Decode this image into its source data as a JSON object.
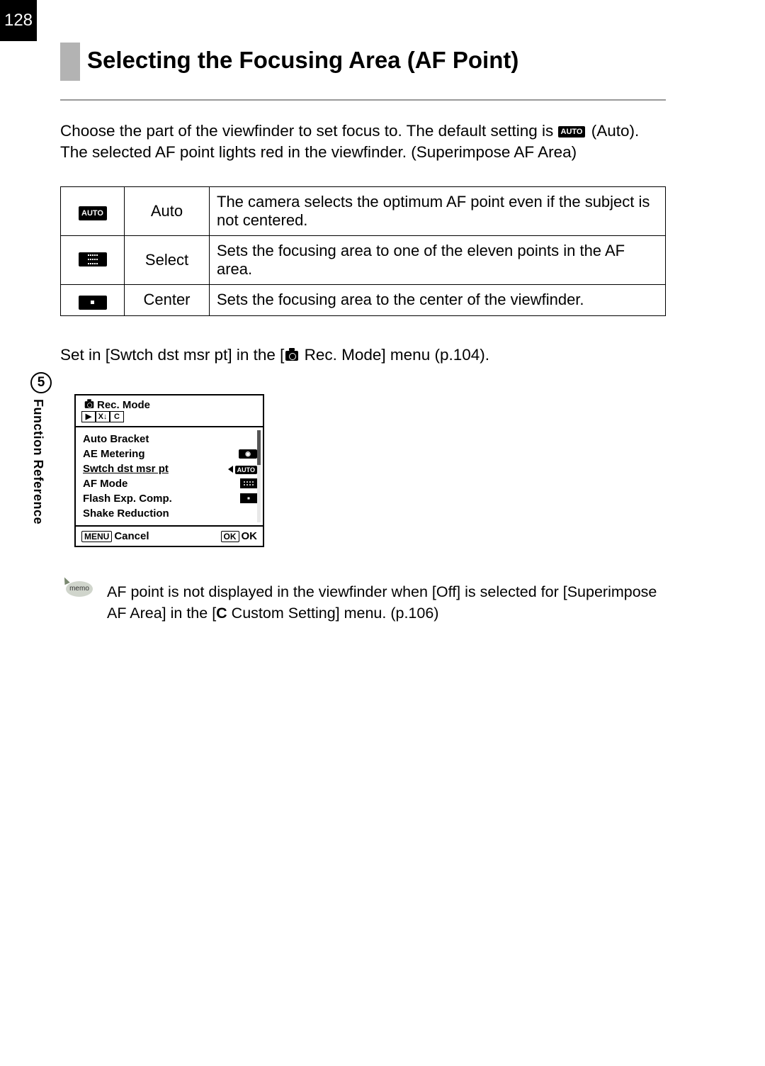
{
  "page_number": "128",
  "chapter": {
    "number": "5",
    "label": "Function Reference"
  },
  "title": "Selecting the Focusing Area (AF Point)",
  "intro": {
    "line1_a": "Choose the part of the viewfinder to set focus to. The default setting is ",
    "auto_badge": "AUTO",
    "line1_b": " (Auto).",
    "line2": "The selected AF point lights red in the viewfinder. (Superimpose AF Area)"
  },
  "table": [
    {
      "icon_text": "AUTO",
      "label": "Auto",
      "desc": "The camera selects the optimum AF point even if the subject is not centered."
    },
    {
      "icon_text": "",
      "label": "Select",
      "desc": "Sets the focusing area to one of the eleven points in the AF area."
    },
    {
      "icon_text": "",
      "label": "Center",
      "desc": "Sets the focusing area to the center of the viewfinder."
    }
  ],
  "setin": {
    "a": "Set in [Swtch dst msr pt] in the [",
    "b": " Rec. Mode] menu (p.104)."
  },
  "menu": {
    "title": "Rec. Mode",
    "tabs": [
      "▶",
      "X↓",
      "C"
    ],
    "items": [
      "Auto Bracket",
      "AE Metering",
      "Swtch dst msr pt",
      "AF Mode",
      "Flash Exp. Comp.",
      "Shake Reduction"
    ],
    "value_auto": "AUTO",
    "footer_menu": "MENU",
    "footer_cancel": "Cancel",
    "footer_ok_box": "OK",
    "footer_ok": "OK"
  },
  "memo": {
    "icon_label": "memo",
    "text_a": "AF point is not displayed in the viewfinder when [Off] is selected for [Superimpose AF Area] in the [",
    "c_label": "C",
    "text_b": " Custom Setting] menu. (p.106)"
  }
}
